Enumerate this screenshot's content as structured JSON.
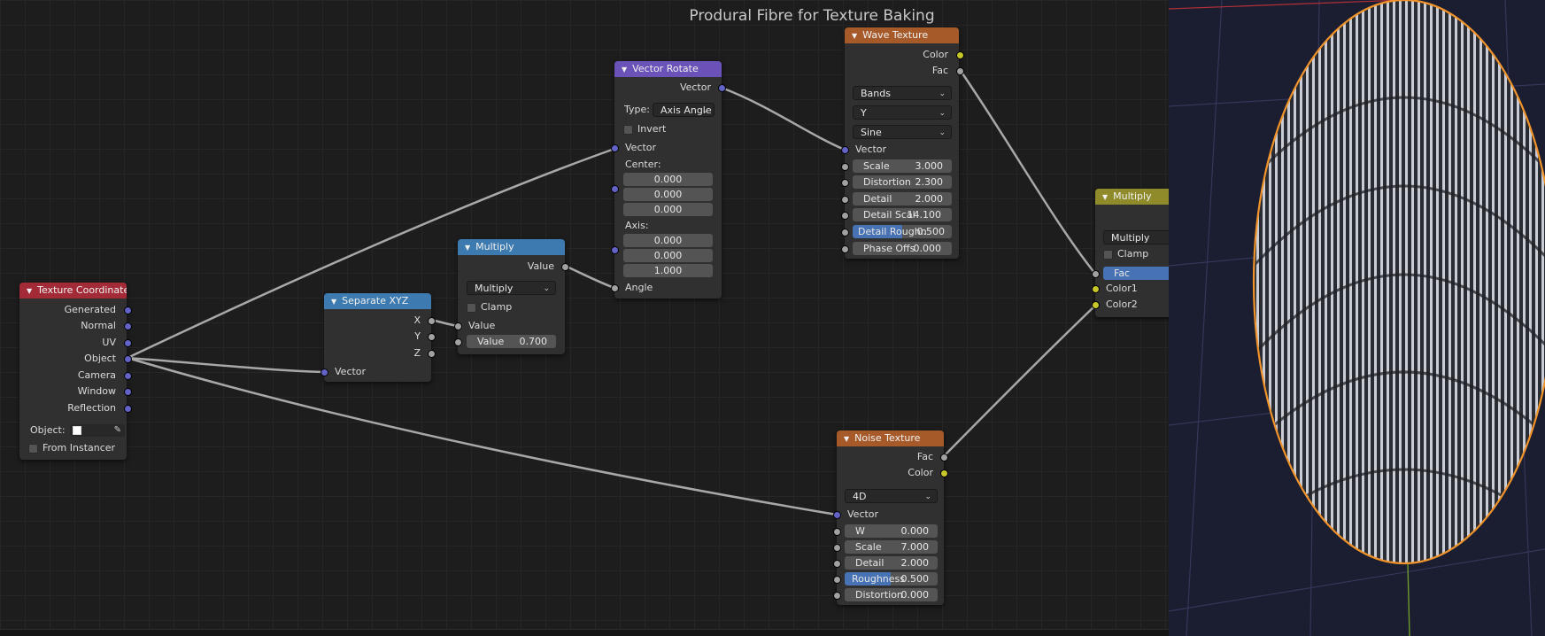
{
  "editor": {
    "title": "Produral Fibre for Texture Baking"
  },
  "nodes": {
    "texture_coordinate": {
      "title": "Texture Coordinate",
      "outputs": [
        "Generated",
        "Normal",
        "UV",
        "Object",
        "Camera",
        "Window",
        "Reflection"
      ],
      "object_label": "Object:",
      "from_instancer": "From Instancer",
      "header_color": "#a32a37"
    },
    "separate_xyz": {
      "title": "Separate XYZ",
      "outputs": [
        "X",
        "Y",
        "Z"
      ],
      "input": "Vector",
      "header_color": "#3c7ab0"
    },
    "multiply_math": {
      "title": "Multiply",
      "output": "Value",
      "operation": "Multiply",
      "clamp": "Clamp",
      "input_value": "Value",
      "value_label": "Value",
      "value": "0.700",
      "header_color": "#3c7ab0"
    },
    "vector_rotate": {
      "title": "Vector Rotate",
      "output": "Vector",
      "type_label": "Type:",
      "type_value": "Axis Angle",
      "invert": "Invert",
      "vector_in": "Vector",
      "center_label": "Center:",
      "center": [
        "0.000",
        "0.000",
        "0.000"
      ],
      "axis_label": "Axis:",
      "axis": [
        "0.000",
        "0.000",
        "1.000"
      ],
      "angle": "Angle",
      "header_color": "#6a52b8"
    },
    "wave_texture": {
      "title": "Wave Texture",
      "outputs": [
        "Color",
        "Fac"
      ],
      "wave_type": "Bands",
      "direction": "Y",
      "profile": "Sine",
      "vector_in": "Vector",
      "fields": [
        {
          "label": "Scale",
          "value": "3.000"
        },
        {
          "label": "Distortion",
          "value": "2.300"
        },
        {
          "label": "Detail",
          "value": "2.000"
        },
        {
          "label": "Detail Scal",
          "value": "14.100"
        },
        {
          "label": "Detail Roughn",
          "value": "0.500"
        },
        {
          "label": "Phase Offs",
          "value": "0.000"
        }
      ],
      "header_color": "#a65a2a"
    },
    "noise_texture": {
      "title": "Noise Texture",
      "outputs": [
        "Fac",
        "Color"
      ],
      "dimensions": "4D",
      "vector_in": "Vector",
      "fields": [
        {
          "label": "W",
          "value": "0.000"
        },
        {
          "label": "Scale",
          "value": "7.000"
        },
        {
          "label": "Detail",
          "value": "2.000"
        },
        {
          "label": "Roughness",
          "value": "0.500"
        },
        {
          "label": "Distortion",
          "value": "0.000"
        }
      ],
      "header_color": "#a65a2a"
    },
    "mix_multiply": {
      "title": "Multiply",
      "blend": "Multiply",
      "clamp": "Clamp",
      "fac": "Fac",
      "color1": "Color1",
      "color2": "Color2",
      "header_color": "#8f8a2a"
    }
  },
  "viewport": {
    "outline_color": "#f0932a"
  }
}
